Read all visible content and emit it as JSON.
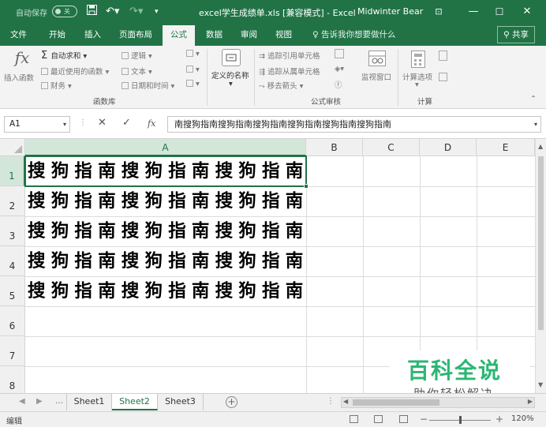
{
  "titlebar": {
    "autosave_label": "自动保存",
    "autosave_state": "关",
    "document_title": "excel学生成绩单.xls  [兼容模式]  -  Excel",
    "user_name": "Midwinter Bear"
  },
  "tabs": [
    {
      "label": "文件"
    },
    {
      "label": "开始"
    },
    {
      "label": "插入"
    },
    {
      "label": "页面布局"
    },
    {
      "label": "公式"
    },
    {
      "label": "数据"
    },
    {
      "label": "审阅"
    },
    {
      "label": "视图"
    }
  ],
  "tell_me": "告诉我你想要做什么",
  "share_label": "共享",
  "ribbon": {
    "insert_function": "插入函数",
    "autosum": "自动求和",
    "recently_used": "最近使用的函数",
    "financial": "财务",
    "logical": "逻辑",
    "text": "文本",
    "date_time": "日期和时间",
    "function_library": "函数库",
    "define_name": "定义的名称",
    "trace_precedents": "追踪引用单元格",
    "trace_dependents": "追踪从属单元格",
    "remove_arrows": "移去箭头",
    "formula_auditing": "公式审核",
    "watch_window": "监视窗口",
    "calc_options": "计算选项",
    "calculation": "计算"
  },
  "formula_bar": {
    "name_box": "A1",
    "content": "南搜狗指南搜狗指南搜狗指南搜狗指南搜狗指南搜狗指南"
  },
  "grid": {
    "columns": [
      "A",
      "B",
      "C",
      "D",
      "E"
    ],
    "rows": [
      "1",
      "2",
      "3",
      "4",
      "5",
      "6",
      "7",
      "8"
    ],
    "cells": [
      "搜狗指南搜狗指南搜狗指南",
      "搜狗指南搜狗指南搜狗指南",
      "搜狗指南搜狗指南搜狗指南",
      "搜狗指南搜狗指南搜狗指南",
      "搜狗指南搜狗指南搜狗指南"
    ]
  },
  "sheets": [
    {
      "label": "Sheet1"
    },
    {
      "label": "Sheet2"
    },
    {
      "label": "Sheet3"
    }
  ],
  "status": {
    "mode": "编辑",
    "zoom": "120%"
  },
  "watermark": {
    "title": "百科全说",
    "subtitle": "助你轻松解决"
  },
  "colors": {
    "brand": "#217346",
    "watermark": "#2bb673"
  }
}
